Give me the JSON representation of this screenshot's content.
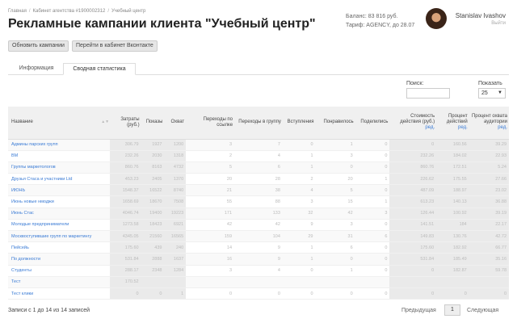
{
  "breadcrumb": [
    "Главная",
    "Кабинет агентства #1900002312",
    "Учебный центр"
  ],
  "title": "Рекламные кампании клиента \"Учебный центр\"",
  "account": {
    "balance": "Баланс: 83 816 руб.",
    "tariff": "Тариф: AGENCY, до 28.07",
    "user_name": "Stanislav Ivashov",
    "logout": "Выйти"
  },
  "buttons": {
    "update": "Обновить кампании",
    "vk": "Перейти в кабинет Вконтакте"
  },
  "tabs": [
    "Информация",
    "Сводная статистика"
  ],
  "filters": {
    "search_label": "Поиск:",
    "search_value": "",
    "show_label": "Показать",
    "show_value": "25"
  },
  "table": {
    "headers": [
      "Название",
      "Затраты (руб.)",
      "Показы",
      "Охват",
      "Переходы по ссылке",
      "Переходы в группу",
      "Вступления",
      "Понравилось",
      "Поделились",
      "Стоимость действия (руб.)",
      "Процент действий",
      "Процент охвата аудитории"
    ],
    "edit_label": "ред.",
    "rows": [
      [
        "Админы парских групп",
        "306.79",
        "1927",
        "1200",
        "3",
        "7",
        "0",
        "1",
        "0",
        "0",
        "160.56",
        "39.29"
      ],
      [
        "ВМ",
        "232.26",
        "2030",
        "1318",
        "2",
        "4",
        "1",
        "3",
        "0",
        "232.26",
        "184.02",
        "22.93"
      ],
      [
        "Группы маркетологов",
        "860.76",
        "8163",
        "4732",
        "5",
        "6",
        "1",
        "0",
        "0",
        "860.76",
        "172.51",
        "5.24"
      ],
      [
        "Друзья Стаса и участники Ltd",
        "453.23",
        "2405",
        "1370",
        "20",
        "28",
        "2",
        "20",
        "1",
        "226.62",
        "175.55",
        "27.66"
      ],
      [
        "ИЮНЬ",
        "1548.37",
        "16522",
        "8740",
        "21",
        "38",
        "4",
        "5",
        "0",
        "487.09",
        "188.97",
        "23.02"
      ],
      [
        "Июнь новые нмоджи",
        "1658.69",
        "18670",
        "7508",
        "55",
        "88",
        "3",
        "15",
        "1",
        "613.23",
        "140.13",
        "36.88"
      ],
      [
        "Июнь Стас",
        "4046.74",
        "19400",
        "19223",
        "171",
        "133",
        "32",
        "42",
        "3",
        "126.44",
        "100.92",
        "39.19"
      ],
      [
        "Молодые предприниматели",
        "1273.58",
        "18423",
        "6921",
        "42",
        "42",
        "9",
        "3",
        "0",
        "141.51",
        "184",
        "22.17"
      ],
      [
        "Москвоступившие групп по маркетингу",
        "4345.05",
        "21560",
        "16565",
        "159",
        "104",
        "29",
        "31",
        "6",
        "149.83",
        "130.76",
        "42.72"
      ],
      [
        "Пейсейь",
        "175.60",
        "439",
        "240",
        "14",
        "9",
        "1",
        "6",
        "0",
        "175.60",
        "182.92",
        "66.77"
      ],
      [
        "По должности",
        "531.84",
        "2888",
        "1637",
        "16",
        "9",
        "1",
        "0",
        "0",
        "531.84",
        "185.49",
        "35.16"
      ],
      [
        "Студенты",
        "288.17",
        "2348",
        "1284",
        "3",
        "4",
        "0",
        "1",
        "0",
        "0",
        "182.87",
        "59.78"
      ],
      [
        "Тест",
        "170.52",
        "",
        "",
        "",
        "",
        "",
        "",
        "",
        "",
        "",
        ""
      ],
      [
        "Тест клики",
        "0",
        "0",
        "1",
        "0",
        "0",
        "0",
        "0",
        "0",
        "0",
        "0",
        "0"
      ]
    ]
  },
  "footer": {
    "info": "Записи с 1 до 14 из 14 записей",
    "prev": "Предыдущая",
    "page": "1",
    "next": "Следующая"
  }
}
